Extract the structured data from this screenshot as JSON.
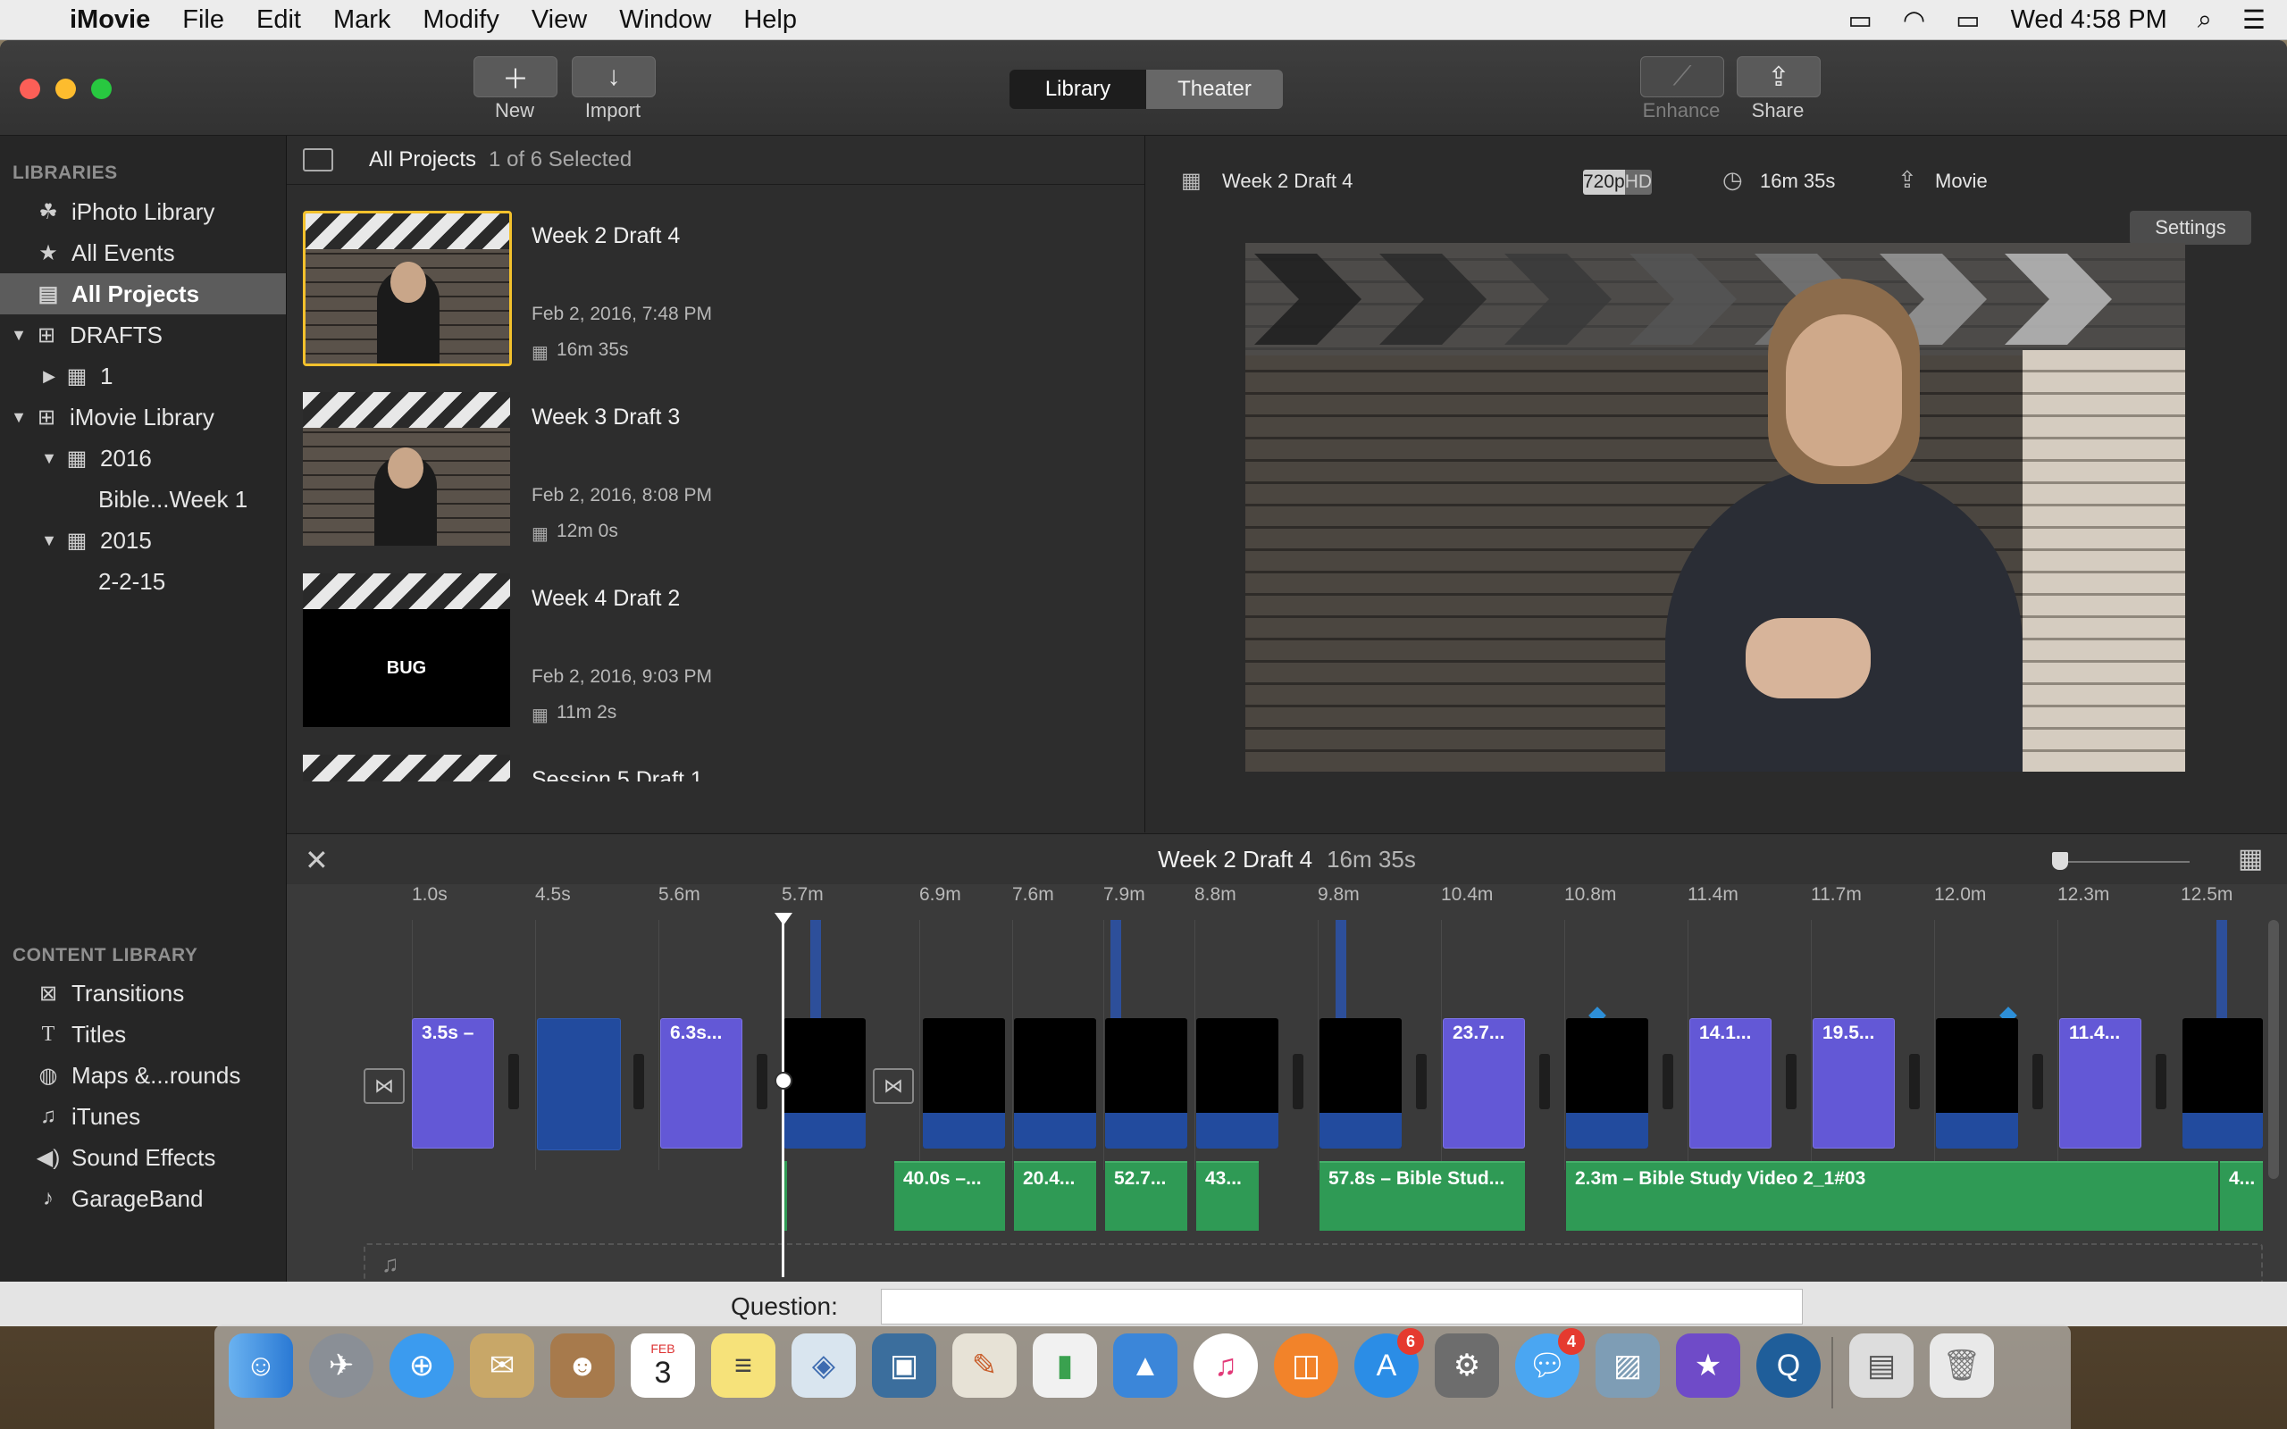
{
  "menubar": {
    "app": "iMovie",
    "items": [
      "File",
      "Edit",
      "Mark",
      "Modify",
      "View",
      "Window",
      "Help"
    ],
    "clock": "Wed 4:58 PM"
  },
  "toolbar": {
    "new_label": "New",
    "import_label": "Import",
    "library_label": "Library",
    "theater_label": "Theater",
    "enhance_label": "Enhance",
    "share_label": "Share"
  },
  "sidebar": {
    "libraries_header": "LIBRARIES",
    "items": [
      {
        "label": "iPhoto Library",
        "icon": "palm-tree-icon"
      },
      {
        "label": "All Events",
        "icon": "star-icon"
      },
      {
        "label": "All Projects",
        "icon": "clapper-icon"
      },
      {
        "label": "DRAFTS",
        "icon": "grid-icon"
      },
      {
        "label": "1",
        "icon": "film-icon"
      },
      {
        "label": "iMovie Library",
        "icon": "grid-icon"
      },
      {
        "label": "2016",
        "icon": "film-icon"
      },
      {
        "label": "Bible...Week 1",
        "icon": ""
      },
      {
        "label": "2015",
        "icon": "film-icon"
      },
      {
        "label": "2-2-15",
        "icon": ""
      }
    ],
    "content_header": "CONTENT LIBRARY",
    "content_items": [
      {
        "label": "Transitions",
        "icon": "transition-icon"
      },
      {
        "label": "Titles",
        "icon": "title-icon"
      },
      {
        "label": "Maps &...rounds",
        "icon": "globe-icon"
      },
      {
        "label": "iTunes",
        "icon": "music-note-icon"
      },
      {
        "label": "Sound Effects",
        "icon": "speaker-icon"
      },
      {
        "label": "GarageBand",
        "icon": "guitar-icon"
      }
    ]
  },
  "projects": {
    "header": "All Projects",
    "selection": "1 of 6 Selected",
    "list": [
      {
        "title": "Week 2 Draft 4",
        "date": "Feb 2, 2016, 7:48 PM",
        "duration": "16m 35s"
      },
      {
        "title": "Week 3 Draft 3",
        "date": "Feb 2, 2016, 8:08 PM",
        "duration": "12m 0s"
      },
      {
        "title": "Week 4 Draft 2",
        "date": "Feb 2, 2016, 9:03 PM",
        "duration": "11m 2s",
        "thumb_text": "BUG"
      },
      {
        "title": "Session 5 Draft 1"
      }
    ]
  },
  "viewer": {
    "project_name": "Week 2 Draft 4",
    "res_720": "720p",
    "res_hd": "HD",
    "duration": "16m 35s",
    "share_type": "Movie",
    "settings_label": "Settings"
  },
  "timeline": {
    "title": "Week 2 Draft 4",
    "duration": "16m 35s",
    "ticks": [
      "1.0s",
      "4.5s",
      "5.6m",
      "5.7m",
      "6.9m",
      "7.6m",
      "7.9m",
      "8.8m",
      "9.8m",
      "10.4m",
      "10.8m",
      "11.4m",
      "11.7m",
      "12.0m",
      "12.3m",
      "12.5m"
    ],
    "video_clips": [
      "3.5s –",
      "6.3s...",
      "23.7...",
      "14.1...",
      "19.5...",
      "11.4..."
    ],
    "audio_clips": [
      "40.0s –...",
      "20.4...",
      "52.7...",
      "43...",
      "57.8s – Bible Stud...",
      "2.3m – Bible Study Video 2_1#03",
      "4..."
    ]
  },
  "question": {
    "label": "Question:"
  },
  "dock": {
    "badges": {
      "app_store": "6",
      "messages": "4"
    },
    "calendar_month": "FEB",
    "calendar_day": "3"
  }
}
